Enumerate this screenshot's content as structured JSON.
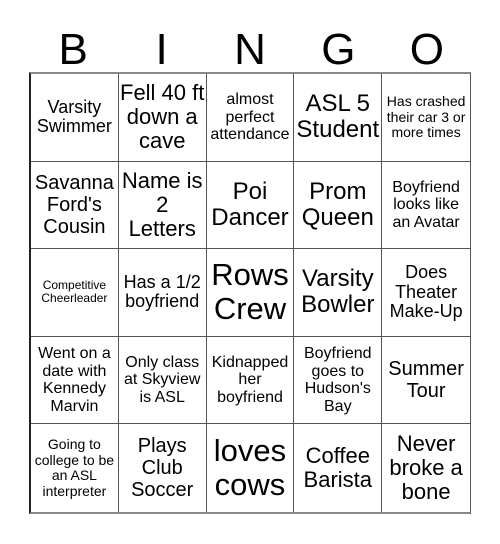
{
  "header": [
    "B",
    "I",
    "N",
    "G",
    "O"
  ],
  "cells": [
    "Varsity Swimmer",
    "Fell 40 ft down a cave",
    "almost perfect attendance",
    "ASL 5 Student",
    "Has crashed their car 3 or more times",
    "Savanna Ford's Cousin",
    "Name is 2 Letters",
    "Poi Dancer",
    "Prom Queen",
    "Boyfriend looks like an Avatar",
    "Competitive Cheerleader",
    "Has a 1/2 boyfriend",
    "Rows Crew",
    "Varsity Bowler",
    "Does Theater Make-Up",
    "Went on a date with Kennedy Marvin",
    "Only class at Skyview is ASL",
    "Kidnapped her boyfriend",
    "Boyfriend goes to Hudson's Bay",
    "Summer Tour",
    "Going to college to be an ASL interpreter",
    "Plays Club Soccer",
    "loves cows",
    "Coffee Barista",
    "Never broke a bone"
  ]
}
